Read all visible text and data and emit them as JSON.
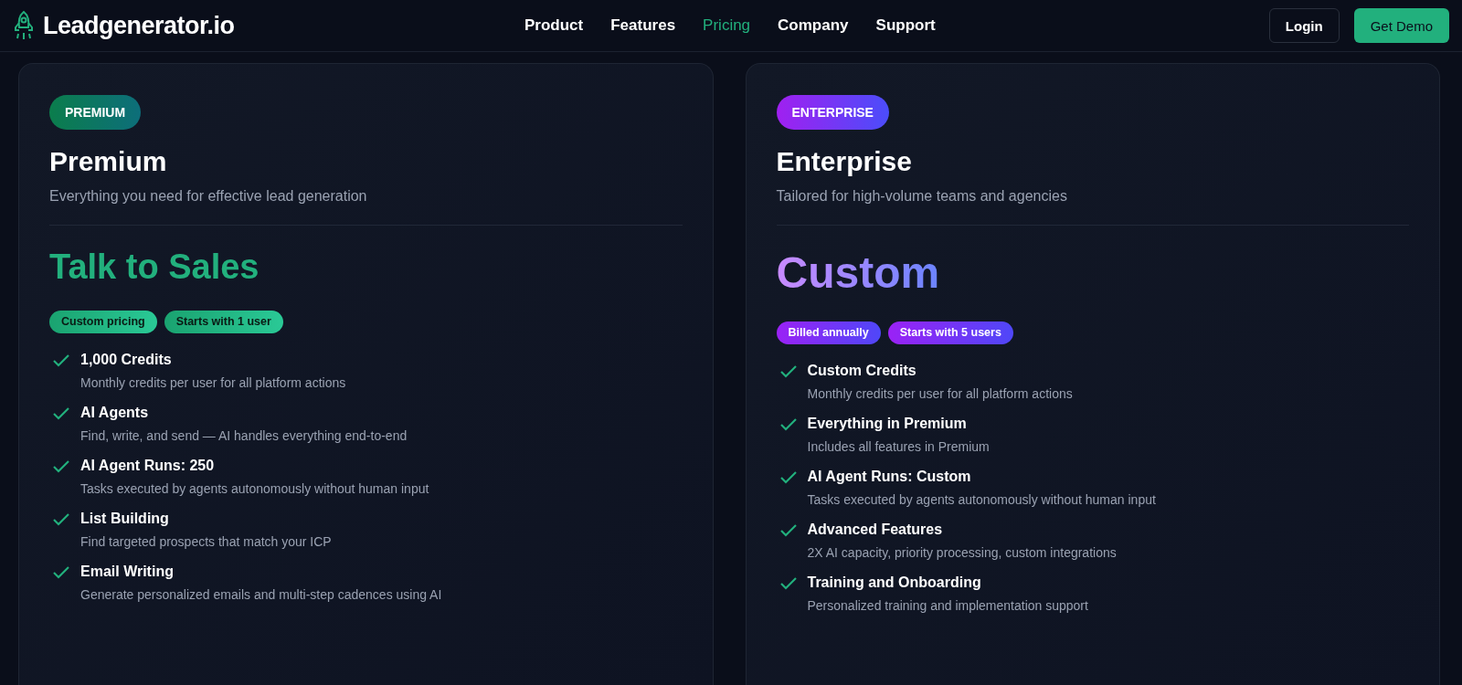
{
  "brand": {
    "name": "Leadgenerator.io"
  },
  "nav": [
    {
      "label": "Product",
      "selected": false
    },
    {
      "label": "Features",
      "selected": false
    },
    {
      "label": "Pricing",
      "selected": true
    },
    {
      "label": "Company",
      "selected": false
    },
    {
      "label": "Support",
      "selected": false
    }
  ],
  "actions": {
    "login": "Login",
    "demo": "Get Demo"
  },
  "plans": [
    {
      "kind": "green",
      "badge": "PREMIUM",
      "name": "Premium",
      "tagline": "Everything you need for effective lead generation",
      "price": "Talk to Sales",
      "pills": [
        "Custom pricing",
        "Starts with 1 user"
      ],
      "features": [
        {
          "title": "1,000 Credits",
          "desc": "Monthly credits per user for all platform actions"
        },
        {
          "title": "AI Agents",
          "desc": "Find, write, and send — AI handles everything end-to-end"
        },
        {
          "title": "AI Agent Runs: 250",
          "desc": "Tasks executed by agents autonomously without human input"
        },
        {
          "title": "List Building",
          "desc": "Find targeted prospects that match your ICP"
        },
        {
          "title": "Email Writing",
          "desc": "Generate personalized emails and multi-step cadences using AI"
        }
      ]
    },
    {
      "kind": "purple",
      "badge": "ENTERPRISE",
      "name": "Enterprise",
      "tagline": "Tailored for high-volume teams and agencies",
      "price": "Custom",
      "pills": [
        "Billed annually",
        "Starts with 5 users"
      ],
      "features": [
        {
          "title": "Custom Credits",
          "desc": "Monthly credits per user for all platform actions"
        },
        {
          "title": "Everything in Premium",
          "desc": "Includes all features in Premium"
        },
        {
          "title": "AI Agent Runs: Custom",
          "desc": "Tasks executed by agents autonomously without human input"
        },
        {
          "title": "Advanced Features",
          "desc": "2X AI capacity, priority processing, custom integrations"
        },
        {
          "title": "Training and Onboarding",
          "desc": "Personalized training and implementation support"
        }
      ]
    }
  ]
}
